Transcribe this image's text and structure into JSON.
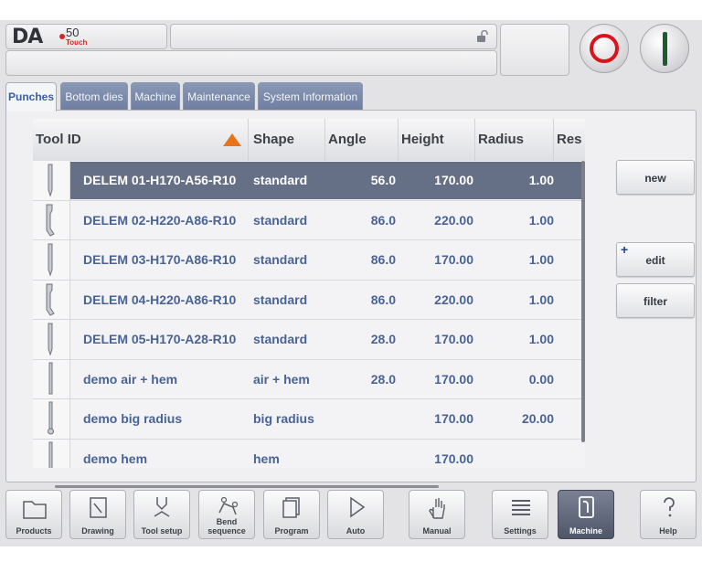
{
  "header": {
    "logo_text": "DA",
    "model_number": "50",
    "model_suffix": "Touch",
    "title": "",
    "status": ""
  },
  "tabs": [
    {
      "label": "Punches",
      "active": true
    },
    {
      "label": "Bottom dies",
      "active": false
    },
    {
      "label": "Machine",
      "active": false
    },
    {
      "label": "Maintenance",
      "active": false
    },
    {
      "label": "System Information",
      "active": false
    }
  ],
  "table": {
    "columns": [
      "Tool ID",
      "Shape",
      "Angle",
      "Height",
      "Radius",
      "Res"
    ],
    "sort_column": "Tool ID",
    "sort_icon": "triangle-up-icon",
    "rows": [
      {
        "id": "DELEM 01-H170-A56-R10",
        "shape": "standard",
        "angle": "56.0",
        "height": "170.00",
        "radius": "1.00",
        "selected": true,
        "profile": "straight"
      },
      {
        "id": "DELEM 02-H220-A86-R10",
        "shape": "standard",
        "angle": "86.0",
        "height": "220.00",
        "radius": "1.00",
        "selected": false,
        "profile": "goose"
      },
      {
        "id": "DELEM 03-H170-A86-R10",
        "shape": "standard",
        "angle": "86.0",
        "height": "170.00",
        "radius": "1.00",
        "selected": false,
        "profile": "straight"
      },
      {
        "id": "DELEM 04-H220-A86-R10",
        "shape": "standard",
        "angle": "86.0",
        "height": "220.00",
        "radius": "1.00",
        "selected": false,
        "profile": "goose"
      },
      {
        "id": "DELEM 05-H170-A28-R10",
        "shape": "standard",
        "angle": "28.0",
        "height": "170.00",
        "radius": "1.00",
        "selected": false,
        "profile": "straight"
      },
      {
        "id": "demo air + hem",
        "shape": "air + hem",
        "angle": "28.0",
        "height": "170.00",
        "radius": "0.00",
        "selected": false,
        "profile": "thin"
      },
      {
        "id": "demo big radius",
        "shape": "big radius",
        "angle": "",
        "height": "170.00",
        "radius": "20.00",
        "selected": false,
        "profile": "round"
      },
      {
        "id": "demo hem",
        "shape": "hem",
        "angle": "",
        "height": "170.00",
        "radius": "",
        "selected": false,
        "profile": "thin"
      }
    ]
  },
  "side_buttons": {
    "new": "new",
    "edit": "edit",
    "edit_marker": "+",
    "filter": "filter"
  },
  "nav": [
    {
      "label": "Products",
      "icon": "folder-icon",
      "active": false
    },
    {
      "label": "Drawing",
      "icon": "drawing-icon",
      "active": false
    },
    {
      "label": "Tool setup",
      "icon": "tool-setup-icon",
      "active": false
    },
    {
      "label": "Bend sequence",
      "icon": "bend-sequence-icon",
      "active": false
    },
    {
      "label": "Program",
      "icon": "program-icon",
      "active": false
    },
    {
      "label": "Auto",
      "icon": "play-icon",
      "active": false
    },
    {
      "label": "Manual",
      "icon": "hand-icon",
      "active": false
    },
    {
      "label": "Settings",
      "icon": "settings-list-icon",
      "active": false
    },
    {
      "label": "Machine",
      "icon": "machine-icon",
      "active": true
    },
    {
      "label": "Help",
      "icon": "help-icon",
      "active": false
    }
  ],
  "colors": {
    "accent": "#4a6395",
    "selected_row": "#657086",
    "sort_arrow": "#e8731e",
    "stop": "#d9141c",
    "start": "#1e5a2f"
  }
}
